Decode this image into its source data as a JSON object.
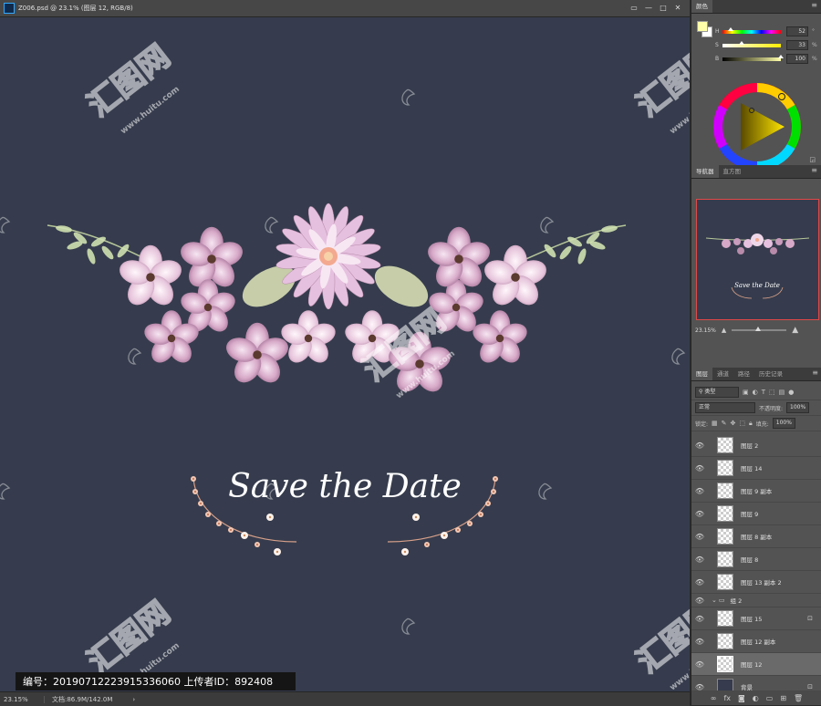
{
  "document": {
    "title": "Z006.psd @ 23.1% (图层 12, RGB/8)",
    "canvas_color": "#363c4d",
    "headline": "Save the Date",
    "watermark_site": "www.huitu.com"
  },
  "window_controls": [
    "▭",
    "—",
    "□",
    "✕"
  ],
  "status_bar": {
    "zoom": "23.15%",
    "doc_info": "文档:86.9M/142.0M",
    "arrow": "›"
  },
  "watermark_bar": {
    "text": "编号：20190712223915336060 上传者ID：892408"
  },
  "panels": {
    "color": {
      "tab": "颜色",
      "h_label": "H",
      "h_value": "52",
      "h_unit": "°",
      "s_label": "S",
      "s_value": "33",
      "s_unit": "%",
      "b_label": "B",
      "b_value": "100",
      "b_unit": "%",
      "foreground_color": "#ffffa9",
      "background_color": "#ffffff",
      "h_fraction": 0.14,
      "s_fraction": 0.33,
      "b_fraction": 1.0
    },
    "navigator": {
      "tabs": [
        "导航器",
        "直方图"
      ],
      "zoom": "23.15%",
      "thumb_text": "Save the Date"
    },
    "layers": {
      "tabs": [
        "图层",
        "通道",
        "路径",
        "历史记录"
      ],
      "filter_label": "类型",
      "blend_mode": "正常",
      "opacity_label": "不透明度:",
      "opacity_value": "100%",
      "lock_label": "锁定:",
      "fill_label": "填充:",
      "fill_value": "100%",
      "items": [
        {
          "name": "图层 2",
          "type": "layer",
          "locked": false,
          "selected": false
        },
        {
          "name": "图层 14",
          "type": "layer",
          "locked": false,
          "selected": false
        },
        {
          "name": "图层 9 副本",
          "type": "layer",
          "locked": false,
          "selected": false
        },
        {
          "name": "图层 9",
          "type": "layer",
          "locked": false,
          "selected": false
        },
        {
          "name": "图层 8 副本",
          "type": "layer",
          "locked": false,
          "selected": false
        },
        {
          "name": "图层 8",
          "type": "layer",
          "locked": false,
          "selected": false
        },
        {
          "name": "图层 13 副本 2",
          "type": "layer",
          "locked": false,
          "selected": false
        },
        {
          "name": "组 2",
          "type": "group",
          "locked": false,
          "selected": false
        },
        {
          "name": "图层 15",
          "type": "layer",
          "locked": true,
          "selected": false
        },
        {
          "name": "图层 12 副本",
          "type": "layer",
          "locked": false,
          "selected": false
        },
        {
          "name": "图层 12",
          "type": "layer",
          "locked": false,
          "selected": true
        },
        {
          "name": "背景",
          "type": "background",
          "locked": true,
          "selected": false
        }
      ]
    }
  }
}
